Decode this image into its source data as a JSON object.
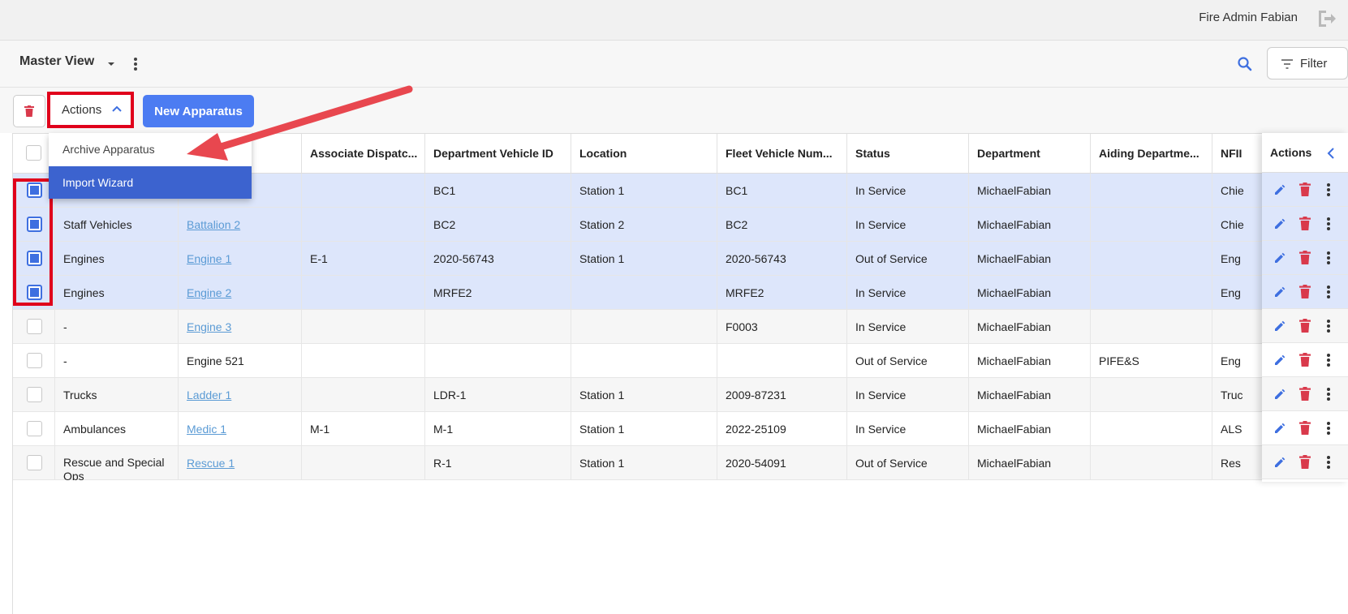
{
  "header": {
    "user_name": "Fire Admin Fabian"
  },
  "view": {
    "title": "Master View",
    "filter_label": "Filter"
  },
  "toolbar": {
    "actions_label": "Actions",
    "new_label": "New Apparatus"
  },
  "dropdown": {
    "items": [
      "Archive Apparatus",
      "Import Wizard"
    ]
  },
  "table": {
    "columns": [
      "",
      "",
      "Associate Dispatc...",
      "Department Vehicle ID",
      "Location",
      "Fleet Vehicle Num...",
      "Status",
      "Department",
      "Aiding Departme...",
      "NFII"
    ],
    "actions_header": "Actions",
    "rows": [
      {
        "checked": true,
        "category": "",
        "name": "",
        "name_link": false,
        "dispatch": "",
        "vehicle_id": "BC1",
        "location": "Station 1",
        "fleet": "BC1",
        "status": "In Service",
        "department": "MichaelFabian",
        "aiding": "",
        "nfirs": "Chie"
      },
      {
        "checked": true,
        "category": "Staff Vehicles",
        "name": "Battalion 2",
        "name_link": true,
        "dispatch": "",
        "vehicle_id": "BC2",
        "location": "Station 2",
        "fleet": "BC2",
        "status": "In Service",
        "department": "MichaelFabian",
        "aiding": "",
        "nfirs": "Chie"
      },
      {
        "checked": true,
        "category": "Engines",
        "name": "Engine 1",
        "name_link": true,
        "dispatch": "E-1",
        "vehicle_id": "2020-56743",
        "location": "Station 1",
        "fleet": "2020-56743",
        "status": "Out of Service",
        "department": "MichaelFabian",
        "aiding": "",
        "nfirs": "Eng"
      },
      {
        "checked": true,
        "category": "Engines",
        "name": "Engine 2",
        "name_link": true,
        "dispatch": "",
        "vehicle_id": "MRFE2",
        "location": "",
        "fleet": "MRFE2",
        "status": "In Service",
        "department": "MichaelFabian",
        "aiding": "",
        "nfirs": "Eng"
      },
      {
        "checked": false,
        "category": "-",
        "name": "Engine 3",
        "name_link": true,
        "dispatch": "",
        "vehicle_id": "",
        "location": "",
        "fleet": "F0003",
        "status": "In Service",
        "department": "MichaelFabian",
        "aiding": "",
        "nfirs": ""
      },
      {
        "checked": false,
        "category": "-",
        "name": "Engine 521",
        "name_link": false,
        "dispatch": "",
        "vehicle_id": "",
        "location": "",
        "fleet": "",
        "status": "Out of Service",
        "department": "MichaelFabian",
        "aiding": "PIFE&S",
        "nfirs": "Eng"
      },
      {
        "checked": false,
        "category": "Trucks",
        "name": "Ladder 1",
        "name_link": true,
        "dispatch": "",
        "vehicle_id": "LDR-1",
        "location": "Station 1",
        "fleet": "2009-87231",
        "status": "In Service",
        "department": "MichaelFabian",
        "aiding": "",
        "nfirs": "Truc"
      },
      {
        "checked": false,
        "category": "Ambulances",
        "name": "Medic 1",
        "name_link": true,
        "dispatch": "M-1",
        "vehicle_id": "M-1",
        "location": "Station 1",
        "fleet": "2022-25109",
        "status": "In Service",
        "department": "MichaelFabian",
        "aiding": "",
        "nfirs": "ALS"
      },
      {
        "checked": false,
        "category": "Rescue and Special Ops",
        "name": "Rescue 1",
        "name_link": true,
        "dispatch": "",
        "vehicle_id": "R-1",
        "location": "Station 1",
        "fleet": "2020-54091",
        "status": "Out of Service",
        "department": "MichaelFabian",
        "aiding": "",
        "nfirs": "Res"
      }
    ]
  },
  "colors": {
    "primary": "#4c7cf2",
    "selected_row": "#dde6fb",
    "danger": "#d9394b",
    "annotation_red": "#e0001b",
    "link": "#5b9bd5"
  },
  "icons": {
    "logout": "logout-icon",
    "search": "search-icon",
    "filter": "filter-icon",
    "delete": "trash-icon",
    "edit": "pencil-icon",
    "more": "kebab-icon"
  }
}
